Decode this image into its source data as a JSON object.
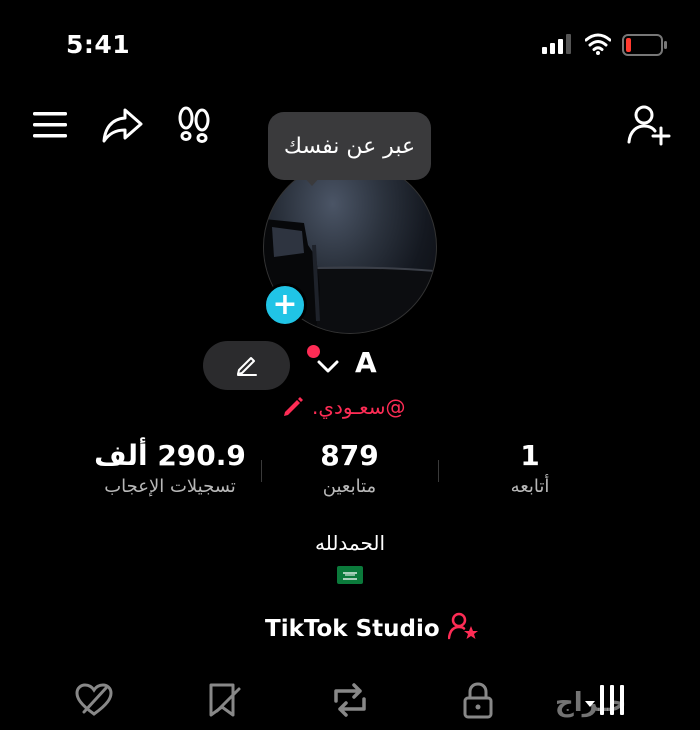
{
  "status_bar": {
    "time": "5:41"
  },
  "tooltip": {
    "text": "عبر عن نفسك"
  },
  "profile": {
    "name": "A",
    "username": "@سعـودي.",
    "bio": "الحمدلله"
  },
  "stats": {
    "likes": {
      "value": "290.9 ألف",
      "label": "تسجيلات الإعجاب"
    },
    "followers": {
      "value": "879",
      "label": "متابعين"
    },
    "following": {
      "value": "1",
      "label": "أتابعه"
    }
  },
  "studio": {
    "label": "TikTok Studio"
  },
  "watermark": {
    "text": "حـراج"
  },
  "colors": {
    "accent": "#fe2c55",
    "plus": "#20c4e6",
    "chip": "#2b2b2d"
  },
  "icons": {
    "top_bar": [
      "menu-icon",
      "share-icon",
      "footprints-icon",
      "add-user-icon"
    ],
    "tabs": [
      "grid-icon",
      "lock-icon",
      "repost-icon",
      "bookmark-icon",
      "liked-icon"
    ]
  }
}
